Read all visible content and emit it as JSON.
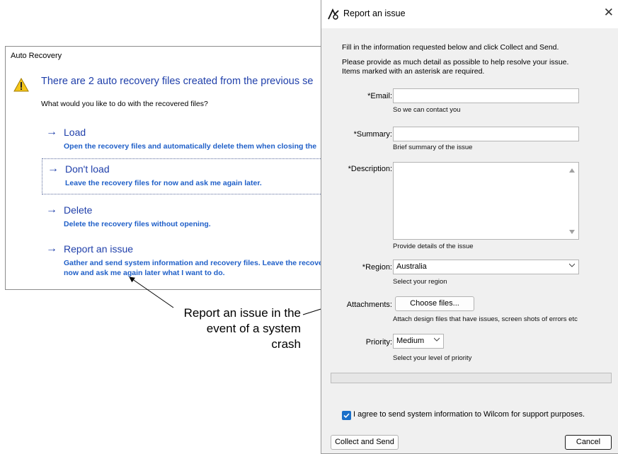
{
  "auto_recovery": {
    "title": "Auto Recovery",
    "headline": "There are 2 auto recovery files created from the  previous se",
    "question": "What would you like to do with the recovered files?",
    "options": [
      {
        "label": "Load",
        "desc": [
          "Open the recovery files and automatically delete them when closing the"
        ]
      },
      {
        "label": "Don't load",
        "desc": [
          "Leave the recovery files for now and ask me again later."
        ]
      },
      {
        "label": "Delete",
        "desc": [
          "Delete the recovery files without opening."
        ]
      },
      {
        "label": "Report an issue",
        "desc": [
          "Gather and send system information and recovery files. Leave the recove",
          "now and ask me again later what I want to do."
        ]
      }
    ]
  },
  "annotation": {
    "lines": [
      "Report an issue in the",
      "event of a system",
      "crash"
    ]
  },
  "report_dialog": {
    "title": "Report an issue",
    "intro1": "Fill in the information requested below and click Collect and Send.",
    "intro2": "Please provide as much detail as possible to help resolve your issue.",
    "intro3": "Items marked with an asterisk are required.",
    "email_label": "*Email:",
    "email_value": "",
    "email_hint": "So we can contact you",
    "summary_label": "*Summary:",
    "summary_value": "",
    "summary_hint": "Brief summary of the issue",
    "description_label": "*Description:",
    "description_value": "",
    "description_hint": "Provide details of the issue",
    "region_label": "*Region:",
    "region_value": "Australia",
    "region_hint": "Select your region",
    "attachments_label": "Attachments:",
    "choose_files": "Choose files...",
    "attachments_hint": "Attach design files that have issues, screen shots of errors etc",
    "priority_label": "Priority:",
    "priority_value": "Medium",
    "priority_hint": "Select your level of priority",
    "agree_label": "I agree to send system information to Wilcom for support purposes.",
    "agree_checked": true,
    "collect_button": "Collect and Send",
    "cancel_button": "Cancel",
    "accent": "#1a6fc9"
  }
}
